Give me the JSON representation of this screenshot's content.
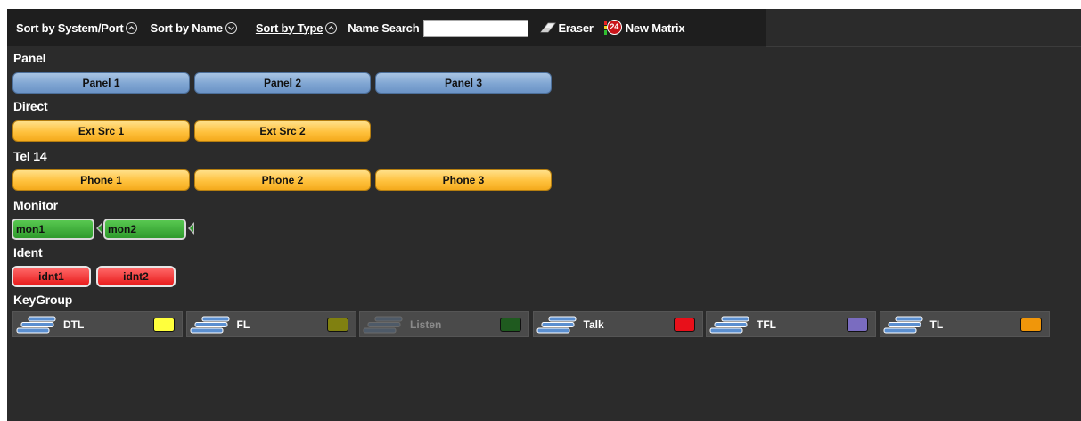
{
  "toolbar": {
    "sort_system": "Sort by System/Port",
    "sort_name": "Sort by Name",
    "sort_type": "Sort by Type",
    "search_label": "Name Search",
    "search_value": "",
    "eraser": "Eraser",
    "matrix_badge": "24",
    "new_matrix": "New Matrix"
  },
  "sections": {
    "panel": {
      "label": "Panel",
      "items": [
        "Panel 1",
        "Panel 2",
        "Panel 3"
      ]
    },
    "direct": {
      "label": "Direct",
      "items": [
        "Ext Src 1",
        "Ext Src 2"
      ]
    },
    "tel": {
      "label": "Tel 14",
      "items": [
        "Phone 1",
        "Phone 2",
        "Phone 3"
      ]
    },
    "monitor": {
      "label": "Monitor",
      "items": [
        "mon1",
        "mon2"
      ]
    },
    "ident": {
      "label": "Ident",
      "items": [
        "idnt1",
        "idnt2"
      ]
    },
    "keygroup": {
      "label": "KeyGroup",
      "items": [
        {
          "label": "DTL",
          "color": "#ffff3c",
          "dim": false
        },
        {
          "label": "FL",
          "color": "#808010",
          "dim": false
        },
        {
          "label": "Listen",
          "color": "#1f5a1f",
          "dim": true
        },
        {
          "label": "Talk",
          "color": "#e8101a",
          "dim": false
        },
        {
          "label": "TFL",
          "color": "#7a6cc0",
          "dim": false
        },
        {
          "label": "TL",
          "color": "#f0960a",
          "dim": false
        }
      ]
    }
  }
}
